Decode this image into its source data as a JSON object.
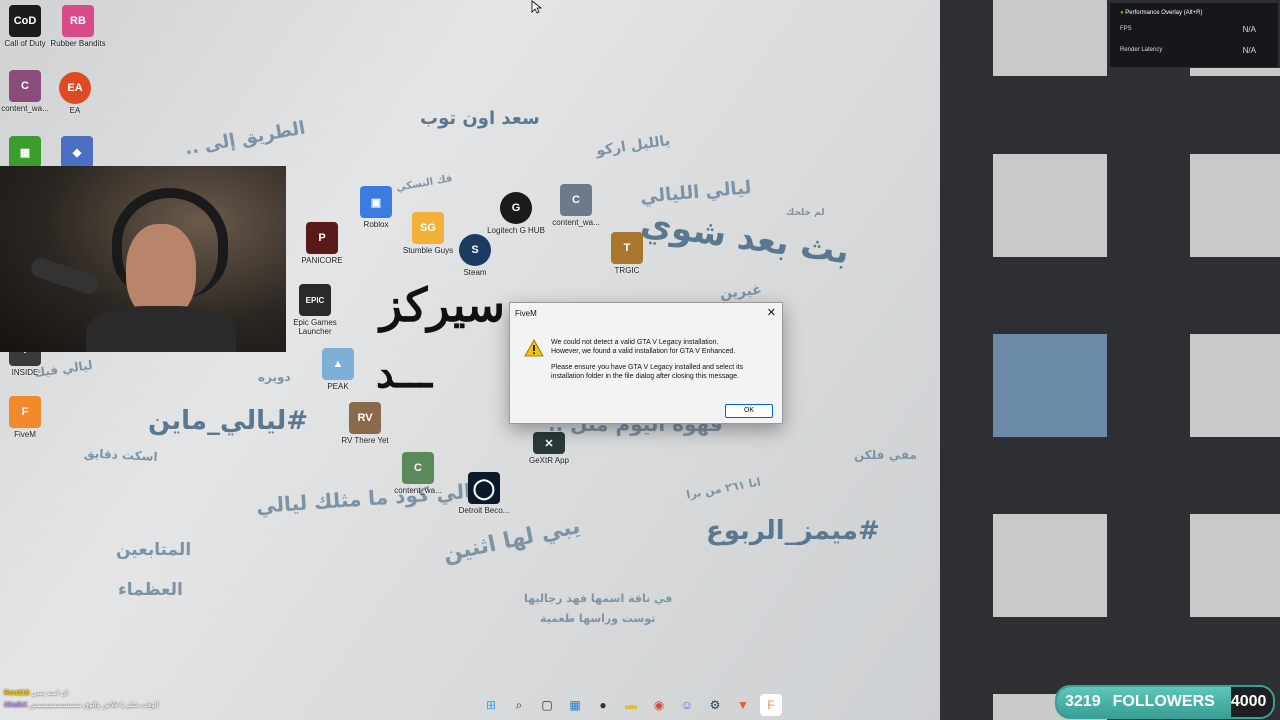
{
  "desktop": {
    "icons": [
      {
        "name": "Call of Duty",
        "glyph": "CoD",
        "color": "#1c1c1c"
      },
      {
        "name": "Rubber Bandits",
        "glyph": "RB",
        "color": "#d84a8a"
      },
      {
        "name": "content_wa...",
        "glyph": "C",
        "color": "#8a4c7a"
      },
      {
        "name": "EA",
        "glyph": "EA",
        "color": "#e04a22"
      },
      {
        "name": "",
        "glyph": "▦",
        "color": "#3d9c2d"
      },
      {
        "name": "",
        "glyph": "◆",
        "color": "#4c6fc4"
      },
      {
        "name": "Roblox",
        "glyph": "▣",
        "color": "#3b7ce0"
      },
      {
        "name": "PANICORE",
        "glyph": "P",
        "color": "#5a1a1a"
      },
      {
        "name": "Stumble Guys",
        "glyph": "SG",
        "color": "#f2b23a"
      },
      {
        "name": "Steam",
        "glyph": "S",
        "color": "#1b3b63"
      },
      {
        "name": "Logitech G HUB",
        "glyph": "G",
        "color": "#1a1a1a"
      },
      {
        "name": "content_wa...",
        "glyph": "C",
        "color": "#6b7b8c"
      },
      {
        "name": "TRGIC",
        "glyph": "T",
        "color": "#a8762c"
      },
      {
        "name": "Epic Games Launcher",
        "glyph": "EPIC",
        "color": "#2a2a2a"
      },
      {
        "name": "INSIDE",
        "glyph": "I",
        "color": "#3a3a3a"
      },
      {
        "name": "PEAK",
        "glyph": "▲",
        "color": "#7cb0d8"
      },
      {
        "name": "FiveM",
        "glyph": "F",
        "color": "#f08a2a"
      },
      {
        "name": "RV There Yet",
        "glyph": "RV",
        "color": "#8a6a4a"
      },
      {
        "name": "content_wa...",
        "glyph": "C",
        "color": "#5a8a5a"
      },
      {
        "name": "Detroit Beco...",
        "glyph": "◯",
        "color": "#0a1a2a"
      },
      {
        "name": "GeXtR App",
        "glyph": "✕",
        "color": "#2a3a3a"
      }
    ],
    "wallpaper_text": [
      "سعد اون توب",
      "يالليل اركو",
      "الطريق إلى ..",
      "ليالي الليالي",
      "بث بعد شوي",
      "سيركز",
      "#ليالي_ماين",
      "اسكت دقايق",
      "قهوة اليوم مثل ..",
      "ليالي كود ما مثلك ليالي",
      "يبي لها اثنين",
      "#ميمز_الربوع",
      "المتابعين",
      "العظماء",
      "مفي فلكن",
      "انا ٢٦١ من برا",
      "في ناقة اسمها فهد رجاليها",
      "توست وراسها طعمية",
      "لم خلجك",
      "غيرين",
      "دويره",
      "ليالي فيك",
      "فك النسكي"
    ]
  },
  "dialog": {
    "title": "FiveM",
    "close": "✕",
    "line1": "We could not detect a valid GTA V Legacy installation.",
    "line2": "However, we found a valid installation for GTA V Enhanced.",
    "line3": "Please ensure you have GTA V Legacy installed and select its installation folder in the file dialog after closing this message.",
    "ok": "OK"
  },
  "overlay": {
    "header": "Performance Overlay (Alt+R)",
    "rows": [
      {
        "label": "FPS",
        "value": "N/A"
      },
      {
        "label": "Render Latency",
        "value": "N/A"
      }
    ]
  },
  "taskbar": {
    "items": [
      {
        "icon": "windows-start-icon",
        "glyph": "⊞",
        "color": "#3aa0f0"
      },
      {
        "icon": "search-icon",
        "glyph": "⌕",
        "color": "#333"
      },
      {
        "icon": "task-view-icon",
        "glyph": "▢",
        "color": "#333"
      },
      {
        "icon": "store-icon",
        "glyph": "▦",
        "color": "#2a7ad0"
      },
      {
        "icon": "app-icon",
        "glyph": "●",
        "color": "#333"
      },
      {
        "icon": "file-explorer-icon",
        "glyph": "▬",
        "color": "#e8b83a"
      },
      {
        "icon": "chrome-icon",
        "glyph": "◉",
        "color": "#d04a3a"
      },
      {
        "icon": "discord-icon",
        "glyph": "☺",
        "color": "#5865f2"
      },
      {
        "icon": "steam-icon",
        "glyph": "⚙",
        "color": "#1b3b63"
      },
      {
        "icon": "brave-icon",
        "glyph": "▼",
        "color": "#f05a28"
      },
      {
        "icon": "fivem-icon",
        "glyph": "F",
        "color": "#f08a2a"
      }
    ]
  },
  "followers": {
    "current": "3219",
    "label": "FOLLOWERS",
    "goal": "4000",
    "progress": 0.80475
  },
  "chat": [
    {
      "user": "Ron218",
      "text": "ان اسه يسي"
    },
    {
      "user": "iStalkX",
      "text": "الوقت شلم يا فلاش والوق سسسسسسسس"
    }
  ],
  "colors": {
    "right_panel": "#2d2f33",
    "window": "#c9c9c9",
    "accent": "#3a9f95"
  }
}
